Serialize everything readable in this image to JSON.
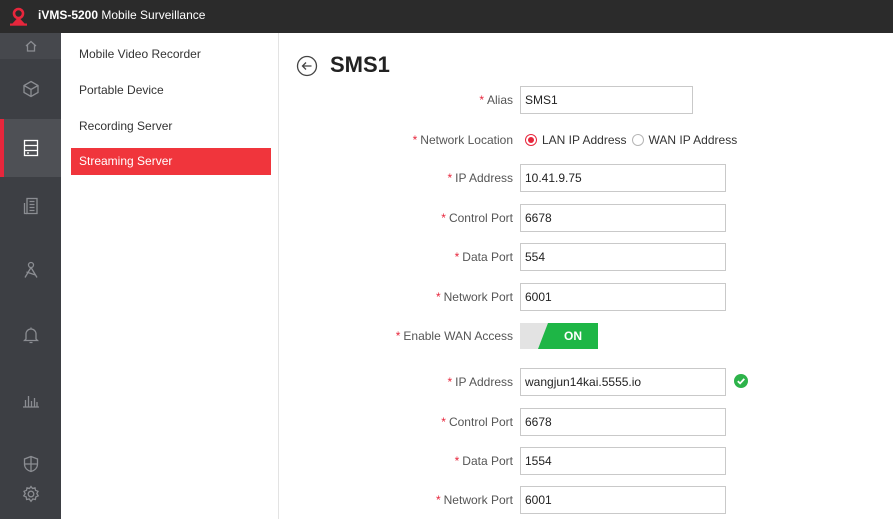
{
  "app": {
    "title_brand": "iVMS-5200",
    "title_rest": " Mobile Surveillance",
    "accent_color": "#e7263c",
    "icon_name": "ivms-logo-icon"
  },
  "rail": {
    "items": [
      {
        "icon": "home-icon",
        "active": false
      },
      {
        "icon": "cube-icon",
        "active": false
      },
      {
        "icon": "server-icon",
        "active": true
      },
      {
        "icon": "building-icon",
        "active": false
      },
      {
        "icon": "map-pin-icon",
        "active": false
      },
      {
        "icon": "bell-icon",
        "active": false
      },
      {
        "icon": "bar-chart-icon",
        "active": false
      },
      {
        "icon": "shield-icon",
        "active": false
      },
      {
        "icon": "gear-icon",
        "active": false
      }
    ]
  },
  "submenu": {
    "items": [
      {
        "label": "Mobile Video Recorder",
        "active": false
      },
      {
        "label": "Portable Device",
        "active": false
      },
      {
        "label": "Recording Server",
        "active": false
      },
      {
        "label": "Streaming Server",
        "active": true
      }
    ]
  },
  "header": {
    "title": "SMS1",
    "back_icon": "back-arrow-circle-icon"
  },
  "form": {
    "required_mark": "*",
    "alias": {
      "label": "Alias",
      "value": "SMS1"
    },
    "network_location": {
      "label": "Network Location",
      "options": [
        "LAN IP Address",
        "WAN IP Address"
      ],
      "selected": "LAN IP Address"
    },
    "lan": {
      "ip_address": {
        "label": "IP Address",
        "value": "10.41.9.75"
      },
      "control_port": {
        "label": "Control Port",
        "value": "6678"
      },
      "data_port": {
        "label": "Data Port",
        "value": "554"
      },
      "network_port": {
        "label": "Network Port",
        "value": "6001"
      }
    },
    "enable_wan_access": {
      "label": "Enable WAN Access",
      "state": "ON",
      "color": "#1eb646"
    },
    "wan": {
      "ip_address": {
        "label": "IP Address",
        "value": "wangjun14kai.5555.io",
        "status_icon": "check-circle-icon"
      },
      "control_port": {
        "label": "Control Port",
        "value": "6678"
      },
      "data_port": {
        "label": "Data Port",
        "value": "1554"
      },
      "network_port": {
        "label": "Network Port",
        "value": "6001"
      }
    }
  }
}
